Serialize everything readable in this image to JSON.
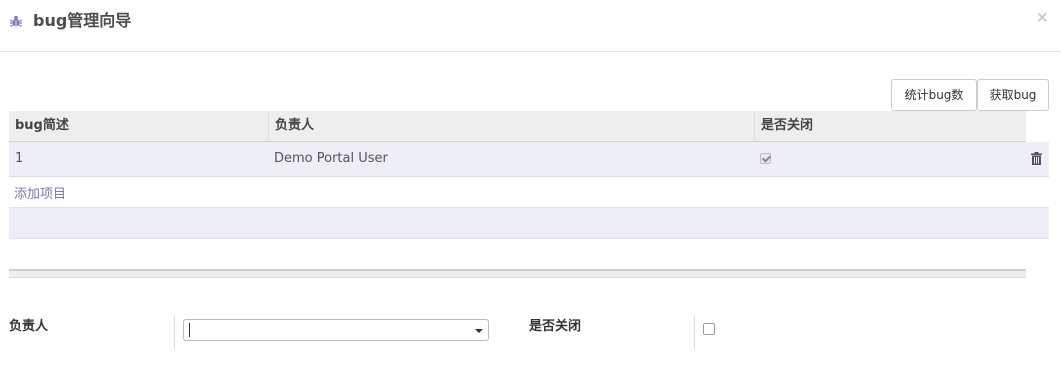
{
  "dialog": {
    "title": "bug管理向导",
    "close_label": "×",
    "icon": "bug-icon"
  },
  "toolbar": {
    "stat_button": "统计bug数",
    "fetch_button": "获取bug"
  },
  "table": {
    "columns": [
      "bug简述",
      "负责人",
      "是否关闭"
    ],
    "rows": [
      {
        "description": "1",
        "owner": "Demo Portal User",
        "closed": true,
        "delete_icon": "trash-icon"
      }
    ],
    "add_item": "添加项目"
  },
  "form": {
    "owner_label": "负责人",
    "owner_value": "",
    "closed_label": "是否关闭",
    "closed_value": false
  },
  "colors": {
    "accent": "#7c7bad",
    "row_bg": "#eeeef6",
    "header_bg": "#eeeeee"
  }
}
